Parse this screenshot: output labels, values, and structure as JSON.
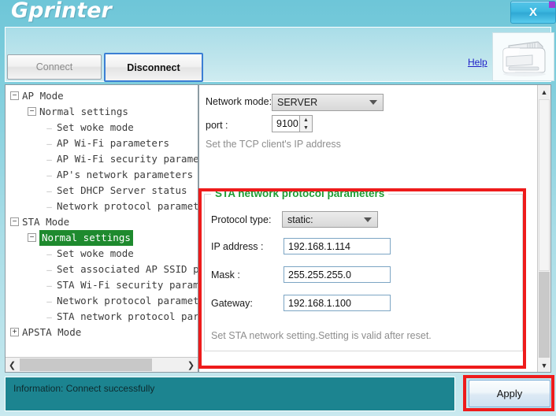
{
  "window": {
    "app_name": "Gprinter",
    "close_label": "X"
  },
  "toolbar": {
    "connect_label": "Connect",
    "disconnect_label": "Disconnect",
    "help_label": "Help",
    "printer_icon": "printer-icon"
  },
  "tree": {
    "nodes": [
      {
        "label": "AP Mode",
        "level": 1,
        "expander": "minus",
        "selected": false
      },
      {
        "label": "Normal settings",
        "level": 2,
        "expander": "minus",
        "selected": false
      },
      {
        "label": "Set woke mode",
        "level": 3,
        "expander": "leaf",
        "selected": false
      },
      {
        "label": "AP Wi-Fi parameters",
        "level": 3,
        "expander": "leaf",
        "selected": false
      },
      {
        "label": "AP Wi-Fi security parameters",
        "level": 3,
        "expander": "leaf",
        "selected": false
      },
      {
        "label": "AP's network parameters",
        "level": 3,
        "expander": "leaf",
        "selected": false
      },
      {
        "label": "Set DHCP Server status",
        "level": 3,
        "expander": "leaf",
        "selected": false
      },
      {
        "label": "Network protocol parameters",
        "level": 3,
        "expander": "leaf",
        "selected": false
      },
      {
        "label": "STA Mode",
        "level": 1,
        "expander": "minus",
        "selected": false
      },
      {
        "label": "Normal settings",
        "level": 2,
        "expander": "minus",
        "selected": true
      },
      {
        "label": "Set woke mode",
        "level": 3,
        "expander": "leaf",
        "selected": false
      },
      {
        "label": "Set associated AP SSID parameters",
        "level": 3,
        "expander": "leaf",
        "selected": false
      },
      {
        "label": "STA Wi-Fi security parameters",
        "level": 3,
        "expander": "leaf",
        "selected": false
      },
      {
        "label": "Network protocol parameters",
        "level": 3,
        "expander": "leaf",
        "selected": false
      },
      {
        "label": "STA network protocol parameters",
        "level": 3,
        "expander": "leaf",
        "selected": false
      },
      {
        "label": "APSTA Mode",
        "level": 1,
        "expander": "plus",
        "selected": false
      }
    ],
    "scroll_left_icon": "chevron-left-icon",
    "scroll_right_icon": "chevron-right-icon"
  },
  "content": {
    "network_mode_label": "Network mode:",
    "network_mode_value": "SERVER",
    "port_label": "port :",
    "port_value": "9100",
    "tcp_hint": "Set the TCP client's IP address",
    "group": {
      "title": "STA network protocol parameters",
      "protocol_type_label": "Protocol type:",
      "protocol_type_value": "static:",
      "ip_label": "IP address :",
      "ip_value": "192.168.1.114",
      "mask_label": "Mask :",
      "mask_value": "255.255.255.0",
      "gateway_label": "Gateway:",
      "gateway_value": "192.168.1.100",
      "footer_hint": "Set STA network setting.Setting is valid after reset."
    },
    "scroll_up_icon": "chevron-up-icon",
    "scroll_down_icon": "chevron-down-icon"
  },
  "status": {
    "message": "Information: Connect successfully",
    "apply_label": "Apply"
  },
  "colors": {
    "accent_teal": "#1c8490",
    "highlight_red": "#ee1b1b",
    "group_title_green": "#1f9c33",
    "tree_selection_green": "#1e8a2e",
    "link_blue": "#1f1fc8"
  }
}
